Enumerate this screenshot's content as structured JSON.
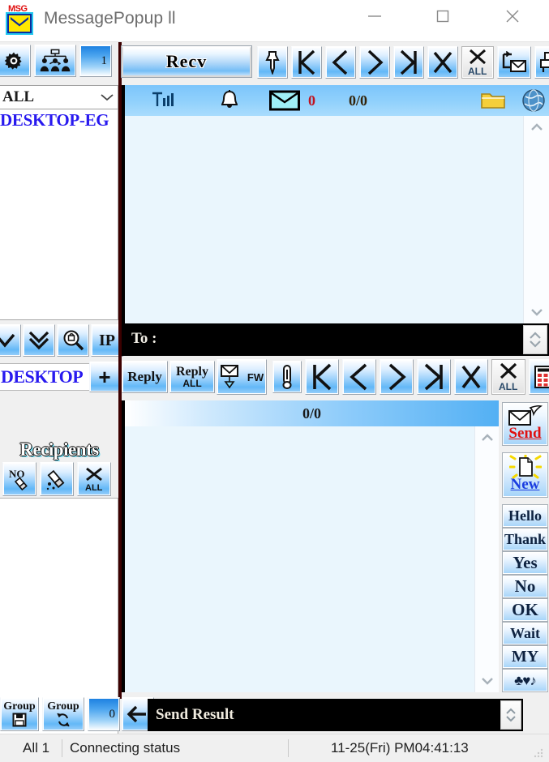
{
  "window": {
    "title": "MessagePopup ll",
    "icon": "msg-envelope-icon",
    "controls": {
      "minimize": "minimize",
      "maximize": "maximize",
      "close": "close"
    }
  },
  "sidebar": {
    "top_buttons": [
      {
        "name": "settings-gear-button",
        "icon": "gear-icon"
      },
      {
        "name": "network-users-button",
        "icon": "network-users-icon"
      },
      {
        "name": "host-count-badge",
        "label": "1"
      }
    ],
    "filter_combo": {
      "value": "ALL",
      "options": [
        "ALL"
      ]
    },
    "host_list": [
      "DESKTOP-EG"
    ],
    "nav_buttons": [
      {
        "name": "move-down-button",
        "icon": "chevron-down-icon"
      },
      {
        "name": "move-down-all-button",
        "icon": "double-chevron-down-icon"
      },
      {
        "name": "search-lock-button",
        "icon": "search-lock-icon"
      },
      {
        "name": "ip-button",
        "label": "IP"
      }
    ],
    "desktop_row": {
      "value": "DESKTOP",
      "add_label": "+"
    },
    "recipients_label": "Recipients",
    "recipient_buttons": [
      {
        "name": "recipient-no-button",
        "label": "NO"
      },
      {
        "name": "recipient-clear-button",
        "icon": "eraser-icon"
      },
      {
        "name": "recipient-clear-all-button",
        "label": "ALL"
      }
    ],
    "group_buttons": [
      {
        "name": "group-save-button",
        "label": "Group",
        "sub": "save-icon"
      },
      {
        "name": "group-refresh-button",
        "label": "Group",
        "sub": "refresh-icon"
      },
      {
        "name": "group-count-badge",
        "label": "0"
      },
      {
        "name": "back-arrow-button",
        "icon": "arrow-left-icon"
      }
    ]
  },
  "main": {
    "recv_button": "Recv",
    "top_toolbar": [
      {
        "name": "pin-button",
        "icon": "pin-icon"
      },
      {
        "name": "first-message-button",
        "icon": "first-icon"
      },
      {
        "name": "previous-message-button",
        "icon": "previous-icon"
      },
      {
        "name": "next-message-button",
        "icon": "next-icon"
      },
      {
        "name": "last-message-button",
        "icon": "last-icon"
      },
      {
        "name": "delete-message-button",
        "icon": "delete-x-icon"
      },
      {
        "name": "delete-all-messages-button",
        "icon": "delete-all-icon",
        "label": "ALL"
      },
      {
        "name": "move-to-folder-button",
        "icon": "move-mail-icon"
      },
      {
        "name": "print-button",
        "icon": "printer-icon"
      },
      {
        "name": "help-button",
        "label": "?"
      }
    ],
    "status_strip": {
      "signal": "signal-bars-icon",
      "bell": "bell-icon",
      "mail": "mail-icon",
      "mail_count": "0",
      "page_counter": "0/0",
      "folder": "folder-icon",
      "globe": "globe-icon"
    },
    "message_body": "",
    "to_field": {
      "label": "To :",
      "value": ""
    },
    "mid_toolbar": [
      {
        "name": "reply-button",
        "label": "Reply"
      },
      {
        "name": "reply-all-button",
        "label": "Reply",
        "sub": "ALL"
      },
      {
        "name": "forward-button",
        "label": "FW",
        "icon": "forward-mail-icon"
      },
      {
        "name": "attach-button",
        "icon": "paperclip-icon"
      },
      {
        "name": "first-recipient-button",
        "icon": "first-icon"
      },
      {
        "name": "previous-recipient-button",
        "icon": "previous-icon"
      },
      {
        "name": "next-recipient-button",
        "icon": "next-icon"
      },
      {
        "name": "last-recipient-button",
        "icon": "last-icon"
      },
      {
        "name": "delete-recipient-button",
        "icon": "delete-x-icon"
      },
      {
        "name": "delete-all-recipients-button",
        "icon": "delete-all-icon",
        "label": "ALL"
      },
      {
        "name": "calculator-button",
        "icon": "calculator-icon"
      },
      {
        "name": "alarm-clock-button",
        "icon": "alarm-clock-icon"
      }
    ],
    "list_header": "0/0",
    "list_rows": []
  },
  "quick_buttons": [
    {
      "name": "send-button",
      "label": "Send",
      "icon": "send-mail-icon"
    },
    {
      "name": "new-button",
      "label": "New",
      "icon": "new-document-icon"
    },
    {
      "name": "hello-button",
      "label": "Hello"
    },
    {
      "name": "thank-button",
      "label": "Thank"
    },
    {
      "name": "yes-button",
      "label": "Yes"
    },
    {
      "name": "no-button",
      "label": "No"
    },
    {
      "name": "ok-button",
      "label": "OK"
    },
    {
      "name": "wait-button",
      "label": "Wait"
    },
    {
      "name": "my-button",
      "label": "MY"
    },
    {
      "name": "symbols-button",
      "label": "♣♥♪"
    }
  ],
  "bottom": {
    "send_result_label": "Send Result"
  },
  "statusbar": {
    "all_count": "All 1",
    "connection": "Connecting status",
    "datetime": "11-25(Fri) PM04:41:13"
  },
  "colors": {
    "accent_blue": "#63b8f7",
    "header_gradient_end": "#53b0f4",
    "body_bg": "#eaf6fd",
    "link_blue": "#2819ef",
    "send_red": "#e01010",
    "divider_dark": "#3c0000"
  }
}
